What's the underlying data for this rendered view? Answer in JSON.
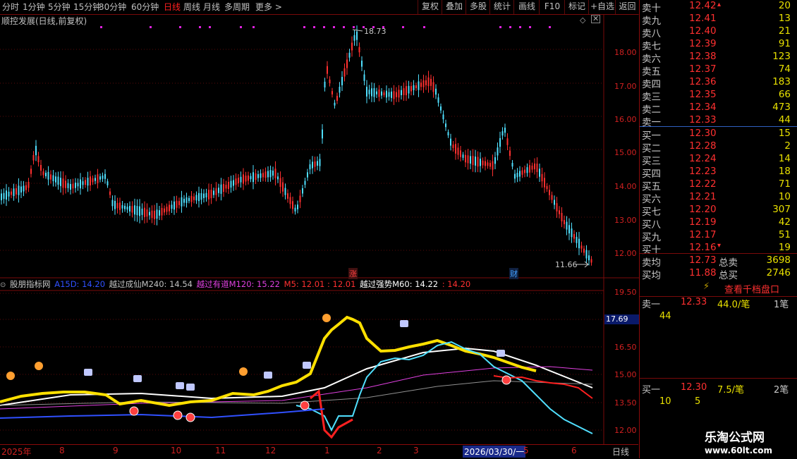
{
  "toolbar": {
    "left_items": [
      "分时",
      "1分钟",
      "5分钟",
      "15分钟",
      "30分钟",
      "60分钟",
      "日线",
      "周线",
      "月线",
      "多周期",
      "更多 >"
    ],
    "active": "日线",
    "right_items": [
      "复权",
      "叠加",
      "多股",
      "统计",
      "画线",
      "F10",
      "标记",
      "+自选",
      "返回"
    ]
  },
  "chart": {
    "title": "顺控发展(日线,前复权)",
    "high_label": "18.73",
    "low_label": "11.66",
    "price_ticks": [
      "18.00",
      "17.00",
      "16.00",
      "15.00",
      "14.00",
      "13.00",
      "12.00"
    ],
    "markers": [
      "涨",
      "财"
    ]
  },
  "indicator": {
    "name": "股朋指标网",
    "parts": [
      {
        "text": "A15D: 14.20",
        "color": "#3050ff"
      },
      {
        "text": "越过成仙M240: 14.54",
        "color": "#c0c0c0"
      },
      {
        "text": "越过有道M120: 15.22",
        "color": "#e040e0"
      },
      {
        "text": "M5: 12.01 : 12.01",
        "color": "#ff3030"
      },
      {
        "text": "越过强势M60: 14.22",
        "color": "#ffffff"
      },
      {
        "text": ": 14.20",
        "color": "#ff3030"
      }
    ],
    "ticks": [
      "19.50",
      "17.69",
      "16.50",
      "15.00",
      "13.50",
      "12.00"
    ]
  },
  "date_axis": {
    "labels": [
      "2025年",
      "8",
      "9",
      "10",
      "11",
      "12",
      "1",
      "2",
      "3",
      "2026/03/30/一",
      "5",
      "6"
    ],
    "period": "日线"
  },
  "orderbook": {
    "asks": [
      {
        "label": "卖十",
        "price": "12.42",
        "vol": "20"
      },
      {
        "label": "卖九",
        "price": "12.41",
        "vol": "13"
      },
      {
        "label": "卖八",
        "price": "12.40",
        "vol": "21"
      },
      {
        "label": "卖七",
        "price": "12.39",
        "vol": "91"
      },
      {
        "label": "卖六",
        "price": "12.38",
        "vol": "123"
      },
      {
        "label": "卖五",
        "price": "12.37",
        "vol": "74"
      },
      {
        "label": "卖四",
        "price": "12.36",
        "vol": "183"
      },
      {
        "label": "卖三",
        "price": "12.35",
        "vol": "66"
      },
      {
        "label": "卖二",
        "price": "12.34",
        "vol": "473"
      },
      {
        "label": "卖一",
        "price": "12.33",
        "vol": "44"
      }
    ],
    "bids": [
      {
        "label": "买一",
        "price": "12.30",
        "vol": "15"
      },
      {
        "label": "买二",
        "price": "12.28",
        "vol": "2"
      },
      {
        "label": "买三",
        "price": "12.24",
        "vol": "14"
      },
      {
        "label": "买四",
        "price": "12.23",
        "vol": "18"
      },
      {
        "label": "买五",
        "price": "12.22",
        "vol": "71"
      },
      {
        "label": "买六",
        "price": "12.21",
        "vol": "10"
      },
      {
        "label": "买七",
        "price": "12.20",
        "vol": "307"
      },
      {
        "label": "买八",
        "price": "12.19",
        "vol": "42"
      },
      {
        "label": "买九",
        "price": "12.17",
        "vol": "51"
      },
      {
        "label": "买十",
        "price": "12.16",
        "vol": "19"
      }
    ],
    "avg_ask_label": "卖均",
    "avg_ask": "12.73",
    "total_ask_label": "总卖",
    "total_ask": "3698",
    "avg_bid_label": "买均",
    "avg_bid": "11.88",
    "total_bid_label": "总买",
    "total_bid": "2746"
  },
  "detail": {
    "link": "查看千档盘口",
    "sell1_label": "卖一",
    "sell1_price": "12.33",
    "sell1_vol": "44.0/笔",
    "sell1_count": "1笔",
    "sell1_sub": "44",
    "buy1_label": "买一",
    "buy1_price": "12.30",
    "buy1_vol": "7.5/笔",
    "buy1_count": "2笔",
    "buy1_sub1": "10",
    "buy1_sub2": "5"
  },
  "watermark": {
    "name": "乐淘公式网",
    "url": "www.60lt.com"
  }
}
